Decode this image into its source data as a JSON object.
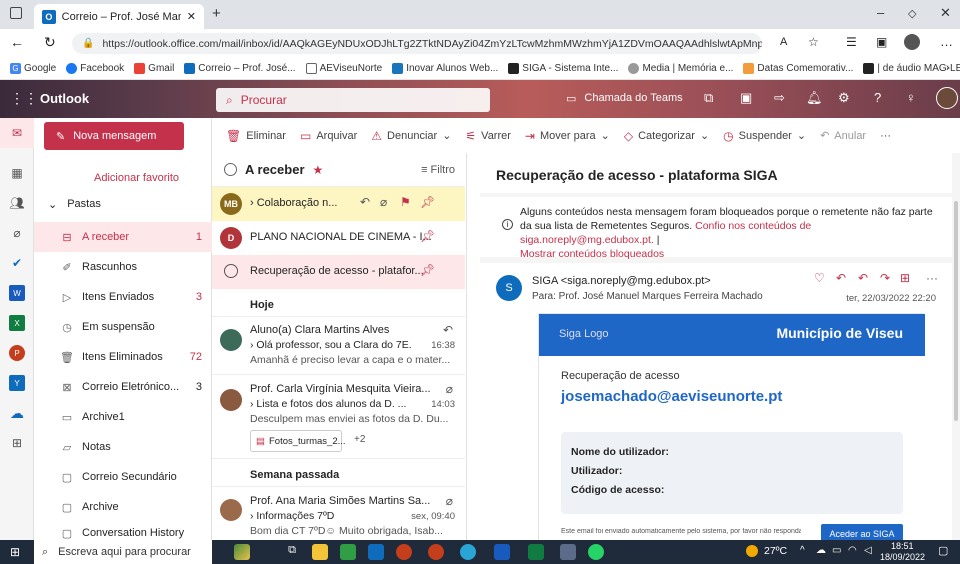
{
  "browser": {
    "tab_title": "Correio – Prof. José Manuel Mar",
    "url": "https://outlook.office.com/mail/inbox/id/AAQkAGEyNDUxODJhLTg2ZTktNDAyZi04ZmYzLTcwMzhmMWzhmYjA1ZDVmOAAQAAdhlslwtApMnpJ4Fzgzt7s%3D",
    "bookmarks": [
      "Google",
      "Facebook",
      "Gmail",
      "Correio – Prof. José...",
      "AEViseuNorte",
      "Inovar Alunos Web...",
      "SIGA - Sistema Inte...",
      "Media | Memória e...",
      "Datas Comemorativ...",
      "| de áudio MAG-LE..."
    ]
  },
  "outlook": {
    "app_name": "Outlook",
    "search_placeholder": "Procurar",
    "teams_label": "Chamada do Teams"
  },
  "folders": {
    "add_favorite": "Adicionar favorito",
    "group_label": "Pastas",
    "items": [
      {
        "label": "A receber",
        "count": "1"
      },
      {
        "label": "Rascunhos",
        "count": ""
      },
      {
        "label": "Itens Enviados",
        "count": "3"
      },
      {
        "label": "Em suspensão",
        "count": ""
      },
      {
        "label": "Itens Eliminados",
        "count": "72"
      },
      {
        "label": "Correio Eletrónico...",
        "count": "3"
      },
      {
        "label": "Archive1",
        "count": ""
      },
      {
        "label": "Notas",
        "count": ""
      },
      {
        "label": "Correio Secundário",
        "count": ""
      },
      {
        "label": "Archive",
        "count": ""
      },
      {
        "label": "Conversation History",
        "count": ""
      }
    ]
  },
  "ribbon": {
    "new_message": "Nova mensagem",
    "buttons": [
      "Eliminar",
      "Arquivar",
      "Denunciar",
      "Varrer",
      "Mover para",
      "Categorizar",
      "Suspender",
      "Anular"
    ]
  },
  "msglist": {
    "header": "A receber",
    "filter": "Filtro",
    "pinned": [
      {
        "avatar": "MB",
        "avatar_color": "#8a6a1a",
        "subject": "Colaboração n..."
      },
      {
        "avatar": "D",
        "avatar_color": "#b0343a",
        "subject": "PLANO NACIONAL DE CINEMA - I..."
      },
      {
        "avatar": "",
        "avatar_color": "",
        "subject": "Recuperação de acesso - platafor..."
      }
    ],
    "section_today": "Hoje",
    "today": [
      {
        "sender": "Aluno(a) Clara Martins Alves",
        "subject": "Olá professor, sou a Clara do 7E.",
        "time": "16:38",
        "preview": "Amanhã é preciso levar a capa e o mater..."
      },
      {
        "sender": "Prof. Carla Virgínia Mesquita Vieira...",
        "subject": "Lista e fotos dos alunos da D. ...",
        "time": "14:03",
        "preview": "Desculpem mas enviei as fotos da D. Du...",
        "attachment": "Fotos_turmas_2...",
        "extra": "+2"
      }
    ],
    "section_last_week": "Semana passada",
    "last_week": [
      {
        "sender": "Prof. Ana Maria Simões Martins Sa...",
        "subject": "Informações 7ºD",
        "time": "sex, 09:40",
        "preview": "Bom dia CT 7ºD☺ Muito obrigada, Isab..."
      }
    ]
  },
  "reading": {
    "subject": "Recuperação de acesso - plataforma SIGA",
    "blocked_text": "Alguns conteúdos nesta mensagem foram bloqueados porque o remetente não faz parte da sua lista de Remetentes Seguros.",
    "trust_link": "Confio nos conteúdos de siga.noreply@mg.edubox.pt.",
    "show_blocked": "Mostrar conteúdos bloqueados",
    "sender_initial": "S",
    "from": "SIGA <siga.noreply@mg.edubox.pt>",
    "to": "Para:  Prof. José Manuel Marques Ferreira Machado",
    "date": "ter, 22/03/2022 22:20",
    "email": {
      "logo_alt": "Siga Logo",
      "municipality": "Município de Viseu",
      "heading": "Recuperação de acesso",
      "account": "josemachado@aeviseunorte.pt",
      "fields": [
        "Nome do utilizador:",
        "Utilizador:",
        "Código de acesso:"
      ],
      "footer": "Este email foi enviado automaticamente pelo sistema, por favor não responda a este email.",
      "button": "Aceder ao SIGA"
    }
  },
  "taskbar": {
    "search": "Escreva aqui para procurar",
    "weather": "27ºC",
    "time": "18:51",
    "date": "18/09/2022"
  }
}
